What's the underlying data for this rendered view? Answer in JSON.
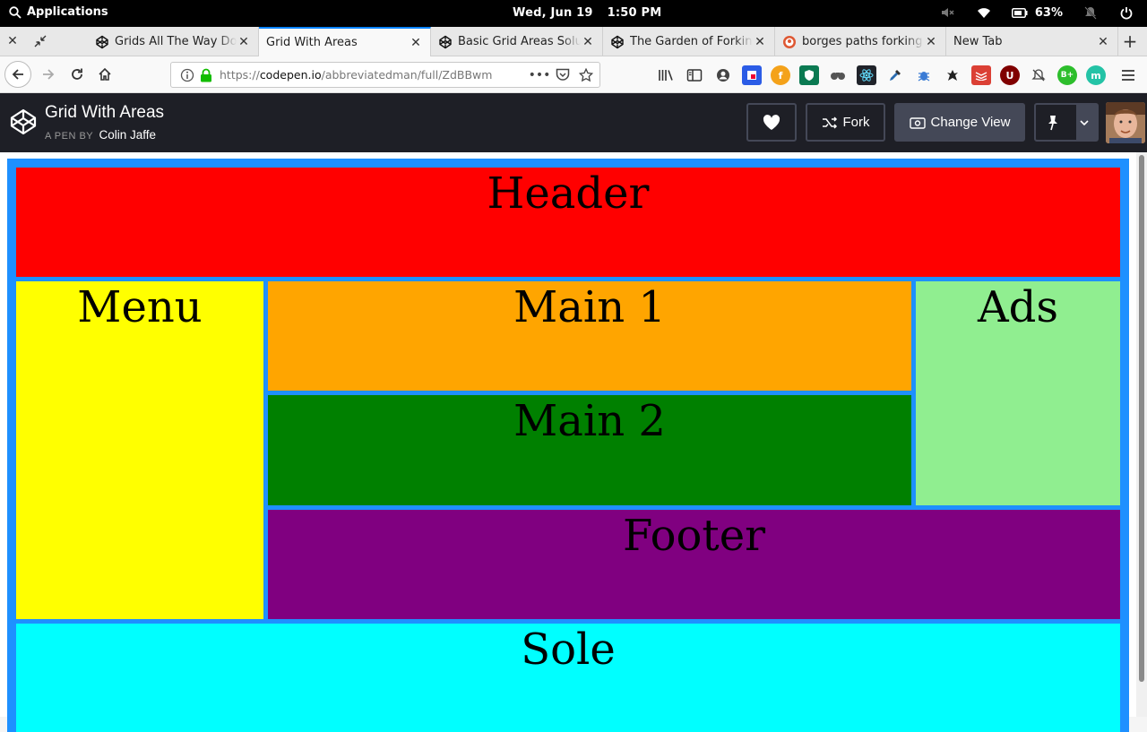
{
  "system": {
    "apps_label": "Applications",
    "date": "Wed, Jun 19",
    "time": "1:50 PM",
    "battery": "63%"
  },
  "tabs": [
    {
      "title": "Grids All The Way Down",
      "favicon": "codepen-icon",
      "active": false
    },
    {
      "title": "Grid With Areas",
      "favicon": "none",
      "active": true
    },
    {
      "title": "Basic Grid Areas Solution",
      "favicon": "codepen-icon",
      "active": false
    },
    {
      "title": "The Garden of Forking Paths",
      "favicon": "codepen-icon",
      "active": false
    },
    {
      "title": "borges paths forking at DuckDuckGo",
      "favicon": "duckduckgo-icon",
      "active": false
    },
    {
      "title": "New Tab",
      "favicon": "none",
      "active": false
    }
  ],
  "address": {
    "scheme": "https://",
    "host": "codepen.io",
    "path": "/abbreviatedman/full/ZdBBwm"
  },
  "codepen": {
    "pen_title": "Grid With Areas",
    "byline": "A PEN BY",
    "author": "Colin Jaffe",
    "fork_label": "Fork",
    "change_view_label": "Change View"
  },
  "grid": {
    "header": "Header",
    "menu": "Menu",
    "main1": "Main 1",
    "main2": "Main 2",
    "ads": "Ads",
    "footer": "Footer",
    "sole": "Sole"
  },
  "colors": {
    "grid_bg": "#1e90ff",
    "header": "#ff0000",
    "menu": "#ffff00",
    "main1": "#ffa500",
    "main2": "#008000",
    "ads": "#90ee90",
    "footer": "#800080",
    "sole": "#00ffff",
    "accent_tab": "#0a84ff"
  }
}
